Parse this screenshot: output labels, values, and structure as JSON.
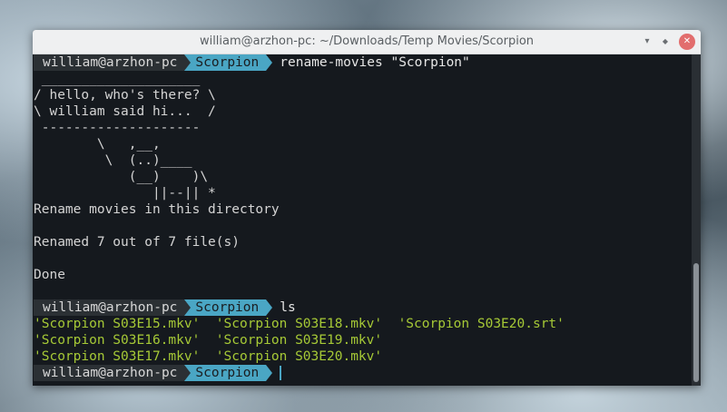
{
  "window": {
    "title": "william@arzhon-pc: ~/Downloads/Temp Movies/Scorpion",
    "min_icon": "minimize-icon",
    "max_icon": "maximize-icon",
    "close_icon": "close-icon"
  },
  "prompt": {
    "user": "william@arzhon-pc",
    "dir": "Scorpion"
  },
  "commands": {
    "first": "rename-movies \"Scorpion\"",
    "second": "ls"
  },
  "cowsay": [
    " ____________________",
    "/ hello, who's there? \\",
    "\\ william said hi...  /",
    " --------------------",
    "        \\   ,__,",
    "         \\  (..)____",
    "            (__)    )\\",
    "               ||--|| *"
  ],
  "output": {
    "rename_msg": "Rename movies in this directory",
    "renamed": "Renamed 7 out of 7 file(s)",
    "done": "Done"
  },
  "ls_rows": [
    "'Scorpion S03E15.mkv'  'Scorpion S03E18.mkv'  'Scorpion S03E20.srt'",
    "'Scorpion S03E16.mkv'  'Scorpion S03E19.mkv'",
    "'Scorpion S03E17.mkv'  'Scorpion S03E20.mkv'"
  ],
  "colors": {
    "accent": "#4aa6c4",
    "file_green": "#a6c936"
  }
}
